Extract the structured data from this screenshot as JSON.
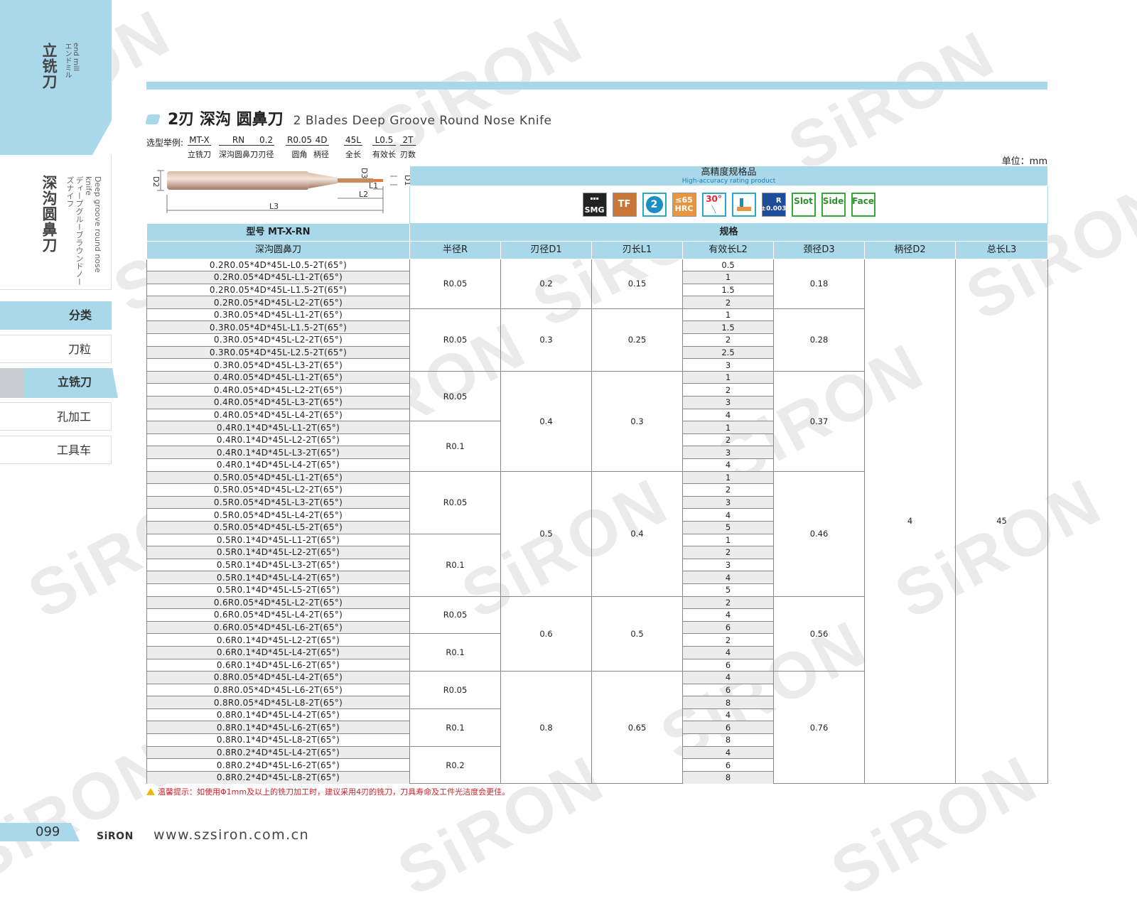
{
  "watermark": "SiRON",
  "sidebar": {
    "section_cn": "立铣刀",
    "section_en": "end mill",
    "section_jp": "エンドミル",
    "product_cn": "深沟圆鼻刀",
    "product_en": "Deep groove round nose knife",
    "product_jp": "ディープグルーブラウンドノーズナイフ",
    "nav": [
      "分类",
      "刀粒",
      "立铣刀",
      "孔加工",
      "工具车"
    ]
  },
  "title": {
    "cn": "2刃 深沟 圆鼻刀",
    "en": "2 Blades Deep Groove Round Nose Knife"
  },
  "example": {
    "label": "选型举例:",
    "items": [
      {
        "code": "MT-X",
        "meaning": "立铣刀"
      },
      {
        "code": "RN",
        "meaning": "深沟圆鼻刀"
      },
      {
        "code": "0.2",
        "meaning": "刃径"
      },
      {
        "code": "R0.05",
        "meaning": "圆角"
      },
      {
        "code": "4D",
        "meaning": "柄径"
      },
      {
        "code": "45L",
        "meaning": "全长"
      },
      {
        "code": "L0.5",
        "meaning": "有效长"
      },
      {
        "code": "2T",
        "meaning": "刃数"
      }
    ]
  },
  "unit": "单位：mm",
  "diagram_labels": {
    "d1": "D1",
    "d2": "D2",
    "d3": "D3",
    "l1": "L1",
    "l2": "L2",
    "l3": "L3"
  },
  "header": {
    "hp_cn": "高精度规格品",
    "hp_en": "High-accuracy rating product",
    "model_label": "型号 MT-X-RN",
    "spec_label": "规格",
    "type_name": "深沟圆鼻刀",
    "columns": [
      "半径R",
      "刃径D1",
      "刃长L1",
      "有效长L2",
      "颈径D3",
      "柄径D2",
      "总长L3"
    ]
  },
  "icons": {
    "smg": "SMG",
    "tf": "TF",
    "two": "2",
    "hrc_top": "≤65",
    "hrc_bottom": "HRC",
    "angle": "30°",
    "tol_r": "R",
    "tol": "±0.003",
    "slot": "Slot",
    "side": "Side",
    "face": "Face",
    "names": [
      "smg-icon",
      "tf-coating-icon",
      "two-flute-icon",
      "hrc-icon",
      "helix-30-icon",
      "layer-icon",
      "tolerance-icon",
      "slot-icon",
      "side-icon",
      "face-icon"
    ]
  },
  "shank_d2": "4",
  "total_l3": "45",
  "groups": [
    {
      "d1": "0.2",
      "l1": "0.15",
      "d3": "0.18",
      "radii": [
        {
          "r": "R0.05",
          "rows": [
            {
              "model": "0.2R0.05*4D*45L-L0.5-2T(65°)",
              "l2": "0.5"
            },
            {
              "model": "0.2R0.05*4D*45L-L1-2T(65°)",
              "l2": "1"
            },
            {
              "model": "0.2R0.05*4D*45L-L1.5-2T(65°)",
              "l2": "1.5"
            },
            {
              "model": "0.2R0.05*4D*45L-L2-2T(65°)",
              "l2": "2"
            }
          ]
        }
      ]
    },
    {
      "d1": "0.3",
      "l1": "0.25",
      "d3": "0.28",
      "radii": [
        {
          "r": "R0.05",
          "rows": [
            {
              "model": "0.3R0.05*4D*45L-L1-2T(65°)",
              "l2": "1"
            },
            {
              "model": "0.3R0.05*4D*45L-L1.5-2T(65°)",
              "l2": "1.5"
            },
            {
              "model": "0.3R0.05*4D*45L-L2-2T(65°)",
              "l2": "2"
            },
            {
              "model": "0.3R0.05*4D*45L-L2.5-2T(65°)",
              "l2": "2.5"
            },
            {
              "model": "0.3R0.05*4D*45L-L3-2T(65°)",
              "l2": "3"
            }
          ]
        }
      ]
    },
    {
      "d1": "0.4",
      "l1": "0.3",
      "d3": "0.37",
      "radii": [
        {
          "r": "R0.05",
          "rows": [
            {
              "model": "0.4R0.05*4D*45L-L1-2T(65°)",
              "l2": "1"
            },
            {
              "model": "0.4R0.05*4D*45L-L2-2T(65°)",
              "l2": "2"
            },
            {
              "model": "0.4R0.05*4D*45L-L3-2T(65°)",
              "l2": "3"
            },
            {
              "model": "0.4R0.05*4D*45L-L4-2T(65°)",
              "l2": "4"
            }
          ]
        },
        {
          "r": "R0.1",
          "rows": [
            {
              "model": "0.4R0.1*4D*45L-L1-2T(65°)",
              "l2": "1"
            },
            {
              "model": "0.4R0.1*4D*45L-L2-2T(65°)",
              "l2": "2"
            },
            {
              "model": "0.4R0.1*4D*45L-L3-2T(65°)",
              "l2": "3"
            },
            {
              "model": "0.4R0.1*4D*45L-L4-2T(65°)",
              "l2": "4"
            }
          ]
        }
      ]
    },
    {
      "d1": "0.5",
      "l1": "0.4",
      "d3": "0.46",
      "radii": [
        {
          "r": "R0.05",
          "rows": [
            {
              "model": "0.5R0.05*4D*45L-L1-2T(65°)",
              "l2": "1"
            },
            {
              "model": "0.5R0.05*4D*45L-L2-2T(65°)",
              "l2": "2"
            },
            {
              "model": "0.5R0.05*4D*45L-L3-2T(65°)",
              "l2": "3"
            },
            {
              "model": "0.5R0.05*4D*45L-L4-2T(65°)",
              "l2": "4"
            },
            {
              "model": "0.5R0.05*4D*45L-L5-2T(65°)",
              "l2": "5"
            }
          ]
        },
        {
          "r": "R0.1",
          "rows": [
            {
              "model": "0.5R0.1*4D*45L-L1-2T(65°)",
              "l2": "1"
            },
            {
              "model": "0.5R0.1*4D*45L-L2-2T(65°)",
              "l2": "2"
            },
            {
              "model": "0.5R0.1*4D*45L-L3-2T(65°)",
              "l2": "3"
            },
            {
              "model": "0.5R0.1*4D*45L-L4-2T(65°)",
              "l2": "4"
            },
            {
              "model": "0.5R0.1*4D*45L-L5-2T(65°)",
              "l2": "5"
            }
          ]
        }
      ]
    },
    {
      "d1": "0.6",
      "l1": "0.5",
      "d3": "0.56",
      "radii": [
        {
          "r": "R0.05",
          "rows": [
            {
              "model": "0.6R0.05*4D*45L-L2-2T(65°)",
              "l2": "2"
            },
            {
              "model": "0.6R0.05*4D*45L-L4-2T(65°)",
              "l2": "4"
            },
            {
              "model": "0.6R0.05*4D*45L-L6-2T(65°)",
              "l2": "6"
            }
          ]
        },
        {
          "r": "R0.1",
          "rows": [
            {
              "model": "0.6R0.1*4D*45L-L2-2T(65°)",
              "l2": "2"
            },
            {
              "model": "0.6R0.1*4D*45L-L4-2T(65°)",
              "l2": "4"
            },
            {
              "model": "0.6R0.1*4D*45L-L6-2T(65°)",
              "l2": "6"
            }
          ]
        }
      ]
    },
    {
      "d1": "0.8",
      "l1": "0.65",
      "d3": "0.76",
      "radii": [
        {
          "r": "R0.05",
          "rows": [
            {
              "model": "0.8R0.05*4D*45L-L4-2T(65°)",
              "l2": "4"
            },
            {
              "model": "0.8R0.05*4D*45L-L6-2T(65°)",
              "l2": "6"
            },
            {
              "model": "0.8R0.05*4D*45L-L8-2T(65°)",
              "l2": "8"
            }
          ]
        },
        {
          "r": "R0.1",
          "rows": [
            {
              "model": "0.8R0.1*4D*45L-L4-2T(65°)",
              "l2": "4"
            },
            {
              "model": "0.8R0.1*4D*45L-L6-2T(65°)",
              "l2": "6"
            },
            {
              "model": "0.8R0.1*4D*45L-L8-2T(65°)",
              "l2": "8"
            }
          ]
        },
        {
          "r": "R0.2",
          "rows": [
            {
              "model": "0.8R0.2*4D*45L-L4-2T(65°)",
              "l2": "4"
            },
            {
              "model": "0.8R0.2*4D*45L-L6-2T(65°)",
              "l2": "6"
            },
            {
              "model": "0.8R0.2*4D*45L-L8-2T(65°)",
              "l2": "8"
            }
          ]
        }
      ]
    }
  ],
  "warning": "温馨提示：如使用Φ1mm及以上的铣刀加工时，建议采用4刃的铣刀，刀具寿命及工件光洁度会更佳。",
  "footer": {
    "page": "099",
    "logo": "SiRON",
    "url": "www.szsiron.com.cn"
  }
}
